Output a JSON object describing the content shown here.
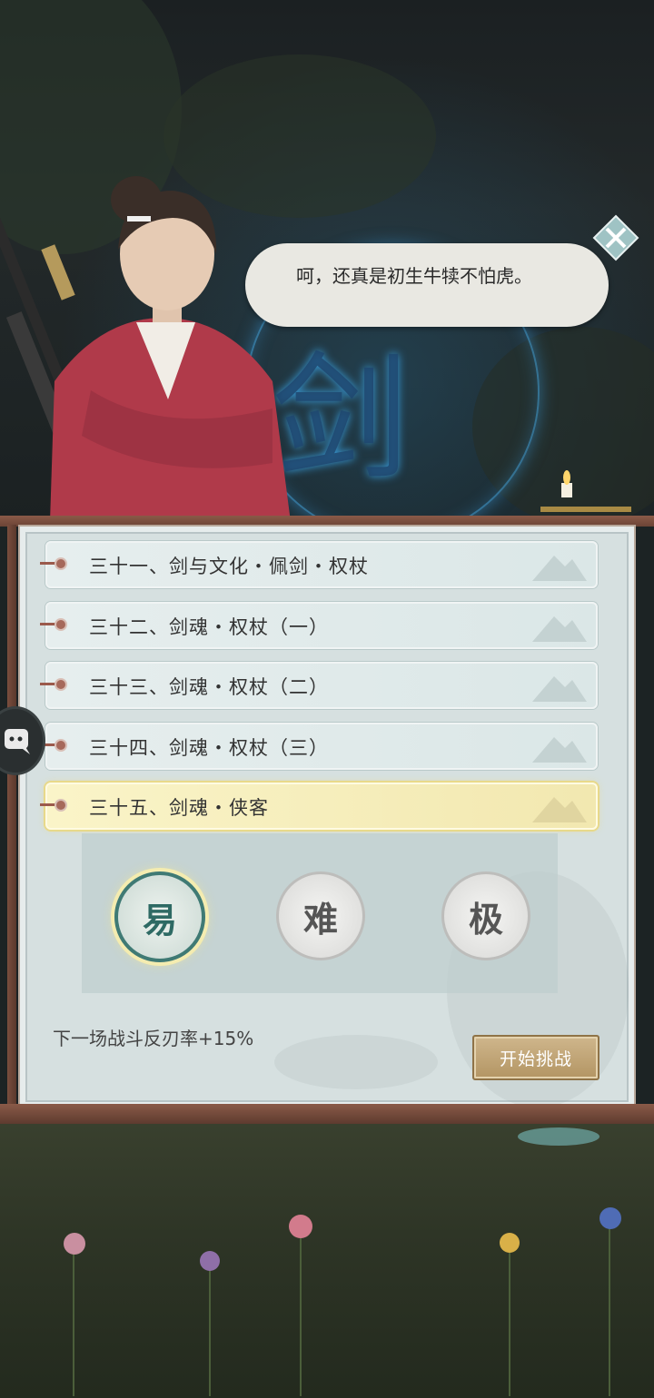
{
  "dialog": {
    "text": "呵，还真是初生牛犊不怕虎。"
  },
  "chapters": [
    {
      "label": "三十一、剑与文化・佩剑・权杖",
      "active": false
    },
    {
      "label": "三十二、剑魂・权杖（一）",
      "active": false
    },
    {
      "label": "三十三、剑魂・权杖（二）",
      "active": false
    },
    {
      "label": "三十四、剑魂・权杖（三）",
      "active": false
    },
    {
      "label": "三十五、剑魂・侠客",
      "active": true
    }
  ],
  "difficulty": {
    "options": [
      {
        "label": "易",
        "selected": true
      },
      {
        "label": "难",
        "selected": false
      },
      {
        "label": "极",
        "selected": false
      }
    ]
  },
  "buff_text": "下一场战斗反刃率+15%",
  "start_button": "开始挑战",
  "icons": {
    "skip": "diamond-close-icon",
    "side_chat": "chat-icon",
    "scene_glyph": "剑"
  },
  "colors": {
    "panel": "#d6e0e0",
    "active_chapter": "#f2e8b0",
    "button": "#b39563",
    "frame": "#6b4436"
  }
}
